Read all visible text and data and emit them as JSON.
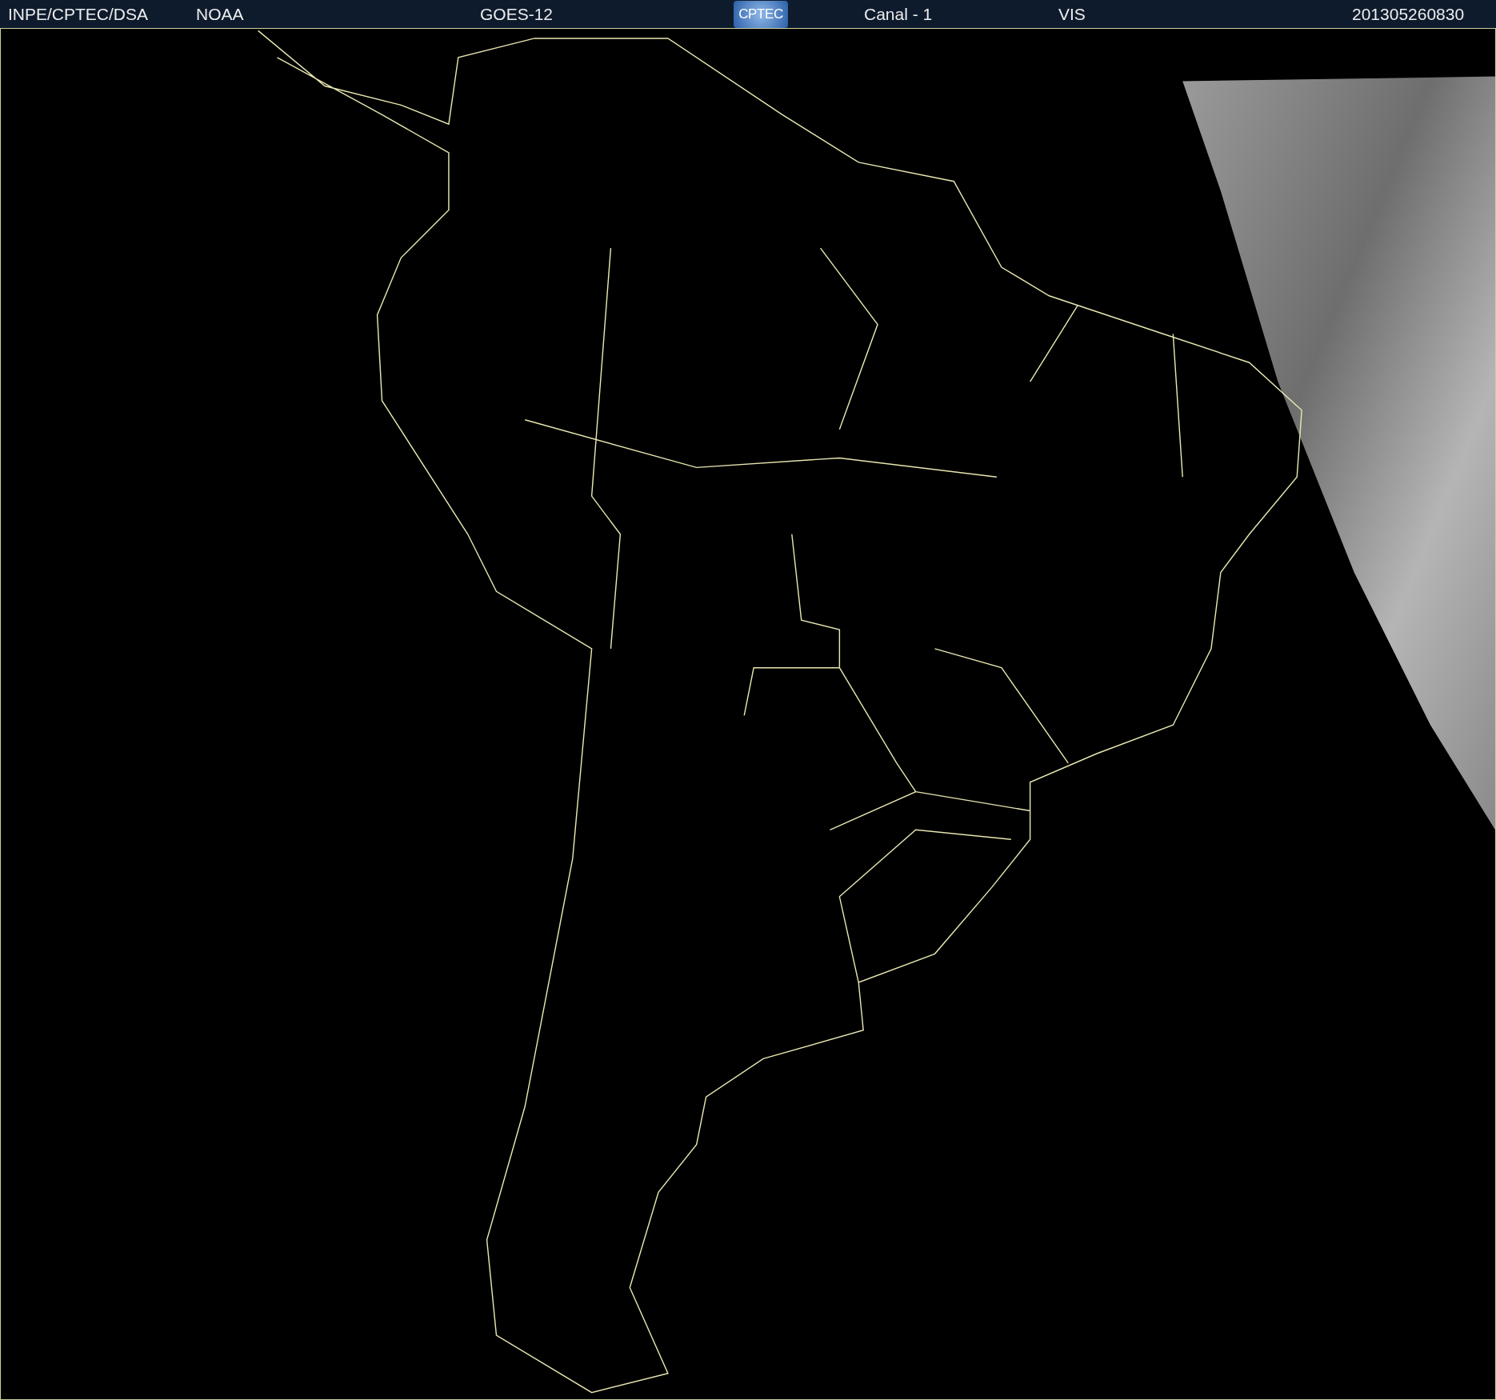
{
  "header": {
    "items": [
      {
        "kind": "text",
        "text": "INPE/CPTEC/DSA"
      },
      {
        "kind": "text",
        "text": "NOAA"
      },
      {
        "kind": "text",
        "text": "GOES-12"
      },
      {
        "kind": "logo",
        "text": "CPTEC"
      },
      {
        "kind": "text",
        "text": "Canal - 1"
      },
      {
        "kind": "text",
        "text": "VIS"
      },
      {
        "kind": "text",
        "text": "201305260830"
      }
    ]
  }
}
